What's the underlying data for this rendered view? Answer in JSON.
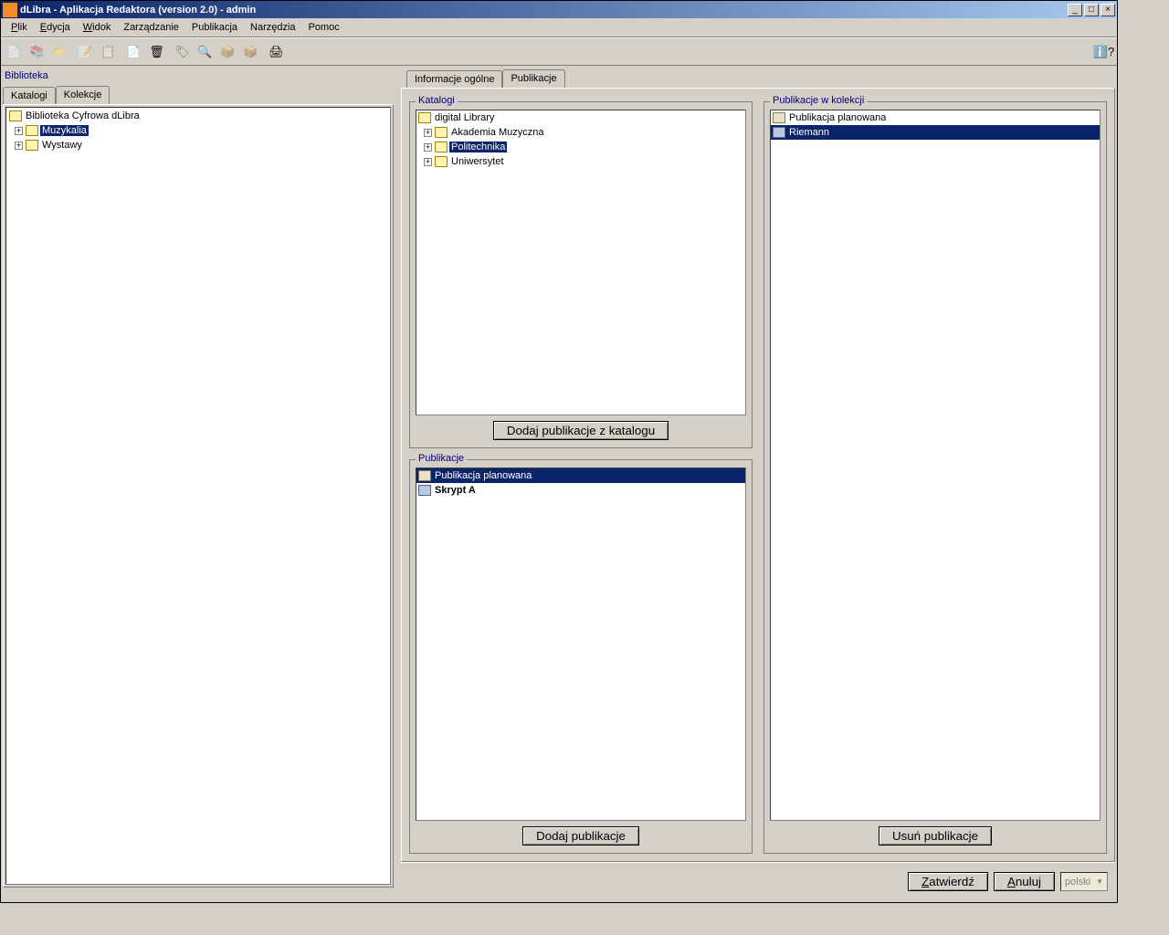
{
  "titlebar": {
    "text": "dLibra - Aplikacja Redaktora (version 2.0) - admin"
  },
  "menus": {
    "plik": "Plik",
    "edycja": "Edycja",
    "widok": "Widok",
    "zarzadzanie": "Zarządzanie",
    "publikacja": "Publikacja",
    "narzedzia": "Narzędzia",
    "pomoc": "Pomoc"
  },
  "left": {
    "section": "Biblioteka",
    "tabs": {
      "katalogi": "Katalogi",
      "kolekcje": "Kolekcje"
    },
    "tree": {
      "root": "Biblioteka Cyfrowa dLibra",
      "items": [
        {
          "label": "Muzykalia",
          "selected": true
        },
        {
          "label": "Wystawy",
          "selected": false
        }
      ]
    }
  },
  "right": {
    "tabs": {
      "ogolne": "Informacje ogólne",
      "publikacje": "Publikacje"
    },
    "katalogi": {
      "legend": "Katalogi",
      "root": "digital Library",
      "items": [
        {
          "label": "Akademia Muzyczna",
          "selected": false
        },
        {
          "label": "Politechnika",
          "selected": true
        },
        {
          "label": "Uniwersytet",
          "selected": false
        }
      ],
      "button": "Dodaj publikacje z katalogu"
    },
    "publikacje": {
      "legend": "Publikacje",
      "items": [
        {
          "label": "Publikacja planowana",
          "selected": true,
          "bold": false,
          "icon": "doc"
        },
        {
          "label": "Skrypt A",
          "selected": false,
          "bold": true,
          "icon": "book"
        }
      ],
      "button": "Dodaj publikacje"
    },
    "wkolekcji": {
      "legend": "Publikacje w kolekcji",
      "items": [
        {
          "label": "Publikacja planowana",
          "selected": false,
          "icon": "doc"
        },
        {
          "label": "Riemann",
          "selected": true,
          "icon": "book"
        }
      ],
      "button": "Usuń publikacje"
    }
  },
  "bottom": {
    "zatwierdz": "Zatwierdź",
    "anuluj": "Anuluj",
    "lang": "polski"
  }
}
